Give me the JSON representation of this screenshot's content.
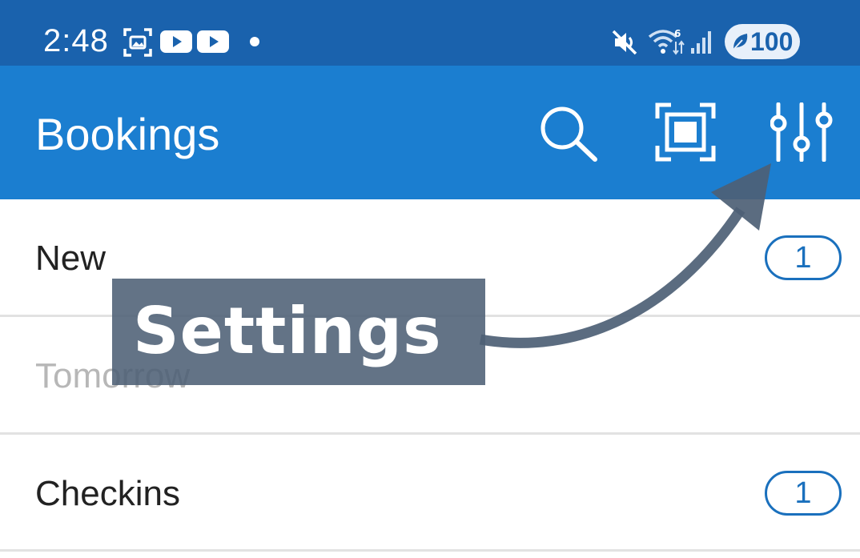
{
  "status_bar": {
    "time": "2:48",
    "battery": "100",
    "icons": [
      "screenshot-icon",
      "youtube-icon",
      "youtube-icon",
      "dot-icon",
      "mute-icon",
      "wifi-icon",
      "signal-icon",
      "battery-saver-icon"
    ]
  },
  "app_bar": {
    "title": "Bookings",
    "actions": [
      "search-icon",
      "scan-icon",
      "filter-sliders-icon"
    ]
  },
  "list": {
    "rows": [
      {
        "label": "New",
        "count": "1"
      },
      {
        "label": "Tomorrow",
        "count": ""
      },
      {
        "label": "Checkins",
        "count": "1"
      }
    ]
  },
  "overlay": {
    "callout_text": "Settings"
  },
  "colors": {
    "status_bar": "#1a62ad",
    "app_bar": "#1b7ed0",
    "badge": "#1a70bd",
    "overlay": "#4d6075"
  }
}
